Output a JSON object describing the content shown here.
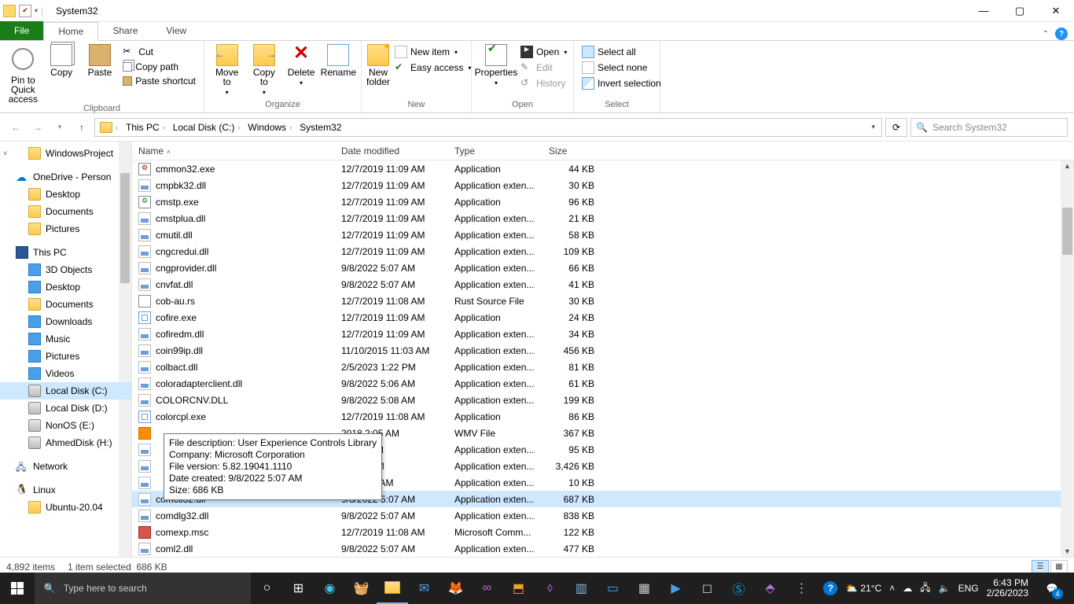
{
  "title": "System32",
  "tabs": {
    "file": "File",
    "home": "Home",
    "share": "Share",
    "view": "View"
  },
  "ribbon": {
    "clipboard": {
      "label": "Clipboard",
      "pin": "Pin to Quick\naccess",
      "copy": "Copy",
      "paste": "Paste",
      "cut": "Cut",
      "copypath": "Copy path",
      "pasteshortcut": "Paste shortcut"
    },
    "organize": {
      "label": "Organize",
      "moveto": "Move\nto",
      "copyto": "Copy\nto",
      "delete": "Delete",
      "rename": "Rename"
    },
    "new": {
      "label": "New",
      "newfolder": "New\nfolder",
      "newitem": "New item",
      "easyaccess": "Easy access"
    },
    "open": {
      "label": "Open",
      "properties": "Properties",
      "open": "Open",
      "edit": "Edit",
      "history": "History"
    },
    "select": {
      "label": "Select",
      "all": "Select all",
      "none": "Select none",
      "invert": "Invert selection"
    }
  },
  "breadcrumb": [
    "This PC",
    "Local Disk (C:)",
    "Windows",
    "System32"
  ],
  "search_placeholder": "Search System32",
  "columns": {
    "name": "Name",
    "date": "Date modified",
    "type": "Type",
    "size": "Size"
  },
  "nav": [
    {
      "label": "WindowsProject",
      "icon": "folder",
      "l": 1,
      "exp": true
    },
    {
      "label": "OneDrive - Person",
      "icon": "cloud",
      "l": 0,
      "space": true
    },
    {
      "label": "Desktop",
      "icon": "folder",
      "l": 1
    },
    {
      "label": "Documents",
      "icon": "folder",
      "l": 1
    },
    {
      "label": "Pictures",
      "icon": "folder",
      "l": 1
    },
    {
      "label": "This PC",
      "icon": "monitor",
      "l": 0,
      "space": true
    },
    {
      "label": "3D Objects",
      "icon": "folder3d",
      "l": 1
    },
    {
      "label": "Desktop",
      "icon": "folderblue",
      "l": 1
    },
    {
      "label": "Documents",
      "icon": "folder",
      "l": 1
    },
    {
      "label": "Downloads",
      "icon": "folderdown",
      "l": 1
    },
    {
      "label": "Music",
      "icon": "foldermusic",
      "l": 1
    },
    {
      "label": "Pictures",
      "icon": "folderpic",
      "l": 1
    },
    {
      "label": "Videos",
      "icon": "foldervid",
      "l": 1
    },
    {
      "label": "Local Disk (C:)",
      "icon": "drive",
      "l": 1,
      "sel": true
    },
    {
      "label": "Local Disk (D:)",
      "icon": "drive",
      "l": 1
    },
    {
      "label": "NonOS (E:)",
      "icon": "drive",
      "l": 1
    },
    {
      "label": "AhmedDisk (H:)",
      "icon": "drive",
      "l": 1
    },
    {
      "label": "Network",
      "icon": "net",
      "l": 0,
      "space": true
    },
    {
      "label": "Linux",
      "icon": "tux",
      "l": 0,
      "space": true
    },
    {
      "label": "Ubuntu-20.04",
      "icon": "folder",
      "l": 1
    }
  ],
  "files": [
    {
      "n": "cmmon32.exe",
      "d": "12/7/2019 11:09 AM",
      "t": "Application",
      "s": "44 KB",
      "i": "exe1"
    },
    {
      "n": "cmpbk32.dll",
      "d": "12/7/2019 11:09 AM",
      "t": "Application exten...",
      "s": "30 KB",
      "i": "dll"
    },
    {
      "n": "cmstp.exe",
      "d": "12/7/2019 11:09 AM",
      "t": "Application",
      "s": "96 KB",
      "i": "exe2"
    },
    {
      "n": "cmstplua.dll",
      "d": "12/7/2019 11:09 AM",
      "t": "Application exten...",
      "s": "21 KB",
      "i": "dll"
    },
    {
      "n": "cmutil.dll",
      "d": "12/7/2019 11:09 AM",
      "t": "Application exten...",
      "s": "58 KB",
      "i": "dll"
    },
    {
      "n": "cngcredui.dll",
      "d": "12/7/2019 11:09 AM",
      "t": "Application exten...",
      "s": "109 KB",
      "i": "dll"
    },
    {
      "n": "cngprovider.dll",
      "d": "9/8/2022 5:07 AM",
      "t": "Application exten...",
      "s": "66 KB",
      "i": "dll"
    },
    {
      "n": "cnvfat.dll",
      "d": "9/8/2022 5:07 AM",
      "t": "Application exten...",
      "s": "41 KB",
      "i": "dll"
    },
    {
      "n": "cob-au.rs",
      "d": "12/7/2019 11:08 AM",
      "t": "Rust Source File",
      "s": "30 KB",
      "i": "rs"
    },
    {
      "n": "cofire.exe",
      "d": "12/7/2019 11:09 AM",
      "t": "Application",
      "s": "24 KB",
      "i": "app"
    },
    {
      "n": "cofiredm.dll",
      "d": "12/7/2019 11:09 AM",
      "t": "Application exten...",
      "s": "34 KB",
      "i": "dll"
    },
    {
      "n": "coin99ip.dll",
      "d": "11/10/2015 11:03 AM",
      "t": "Application exten...",
      "s": "456 KB",
      "i": "dll"
    },
    {
      "n": "colbact.dll",
      "d": "2/5/2023 1:22 PM",
      "t": "Application exten...",
      "s": "81 KB",
      "i": "dll"
    },
    {
      "n": "coloradapterclient.dll",
      "d": "9/8/2022 5:06 AM",
      "t": "Application exten...",
      "s": "61 KB",
      "i": "dll"
    },
    {
      "n": "COLORCNV.DLL",
      "d": "9/8/2022 5:08 AM",
      "t": "Application exten...",
      "s": "199 KB",
      "i": "dll"
    },
    {
      "n": "colorcpl.exe",
      "d": "12/7/2019 11:08 AM",
      "t": "Application",
      "s": "86 KB",
      "i": "cpl"
    },
    {
      "n": "",
      "d": "2018 2:05 AM",
      "t": "WMV File",
      "s": "367 KB",
      "i": "wmv",
      "hide": true
    },
    {
      "n": "",
      "d": "2 5:07 AM",
      "t": "Application exten...",
      "s": "95 KB",
      "i": "dll",
      "hide": true
    },
    {
      "n": "",
      "d": "3 1:23 PM",
      "t": "Application exten...",
      "s": "3,426 KB",
      "i": "dll",
      "hide": true
    },
    {
      "n": "",
      "d": "19 11:08 AM",
      "t": "Application exten...",
      "s": "10 KB",
      "i": "dll",
      "hide": true
    },
    {
      "n": "comctl32.dll",
      "d": "9/8/2022 5:07 AM",
      "t": "Application exten...",
      "s": "687 KB",
      "i": "dll",
      "sel": true
    },
    {
      "n": "comdlg32.dll",
      "d": "9/8/2022 5:07 AM",
      "t": "Application exten...",
      "s": "838 KB",
      "i": "dll"
    },
    {
      "n": "comexp.msc",
      "d": "12/7/2019 11:08 AM",
      "t": "Microsoft Comm...",
      "s": "122 KB",
      "i": "msc"
    },
    {
      "n": "coml2.dll",
      "d": "9/8/2022 5:07 AM",
      "t": "Application exten...",
      "s": "477 KB",
      "i": "dll"
    }
  ],
  "tooltip": {
    "l1": "File description: User Experience Controls Library",
    "l2": "Company: Microsoft Corporation",
    "l3": "File version: 5.82.19041.1110",
    "l4": "Date created: 9/8/2022 5:07 AM",
    "l5": "Size: 686 KB"
  },
  "status": {
    "items": "4,892 items",
    "selected": "1 item selected",
    "size": "686 KB"
  },
  "taskbar": {
    "search_placeholder": "Type here to search",
    "weather": "21°C",
    "lang": "ENG",
    "time": "6:43 PM",
    "date": "2/26/2023",
    "notif": "4"
  }
}
